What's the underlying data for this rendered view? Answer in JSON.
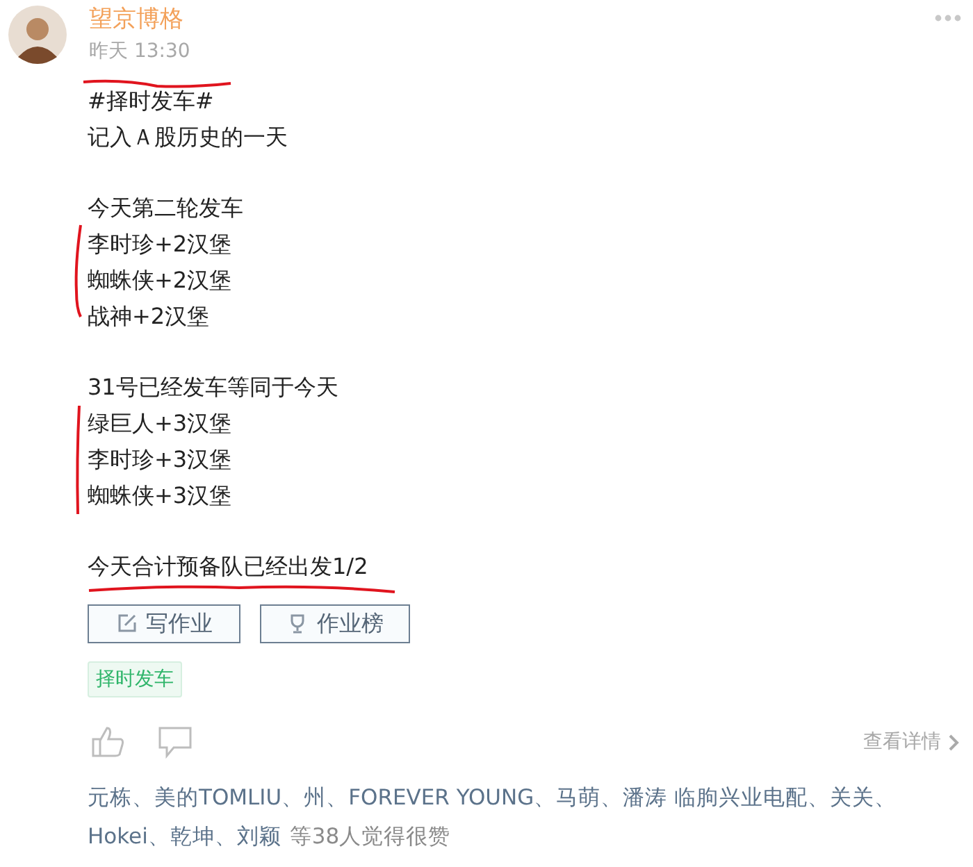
{
  "author": {
    "name": "望京博格",
    "time": "昨天 13:30"
  },
  "sections": [
    [
      "#择时发车#",
      "记入Ａ股历史的一天"
    ],
    [
      "今天第二轮发车",
      "李时珍+2汉堡",
      "蜘蛛侠+2汉堡",
      "战神+2汉堡"
    ],
    [
      "31号已经发车等同于今天",
      "绿巨人+3汉堡",
      "李时珍+3汉堡",
      "蜘蛛侠+3汉堡"
    ],
    [
      "今天合计预备队已经出发1/2"
    ]
  ],
  "buttons": [
    {
      "kind": "edit",
      "label": "写作业"
    },
    {
      "kind": "trophy",
      "label": "作业榜"
    }
  ],
  "tags": [
    "择时发车"
  ],
  "details_link": "查看详情",
  "likes": {
    "names": [
      "元栋、美的TOMLIU、州、FOREVER YOUNG、马萌、潘涛 临朐兴业电配、关关、",
      "Hokei、乾坤、刘颖"
    ],
    "suffix": "等38人觉得很赞"
  }
}
